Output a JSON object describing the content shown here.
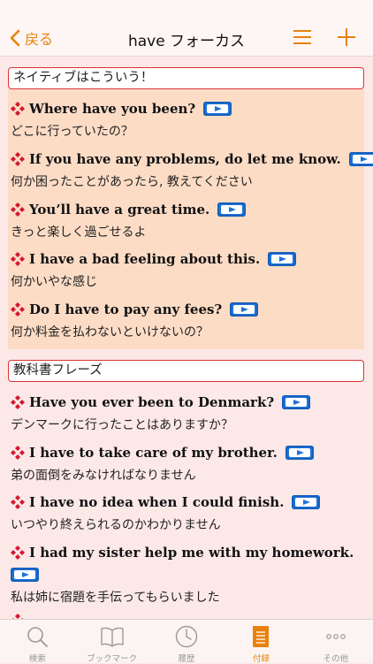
{
  "nav": {
    "back_label": "戻る",
    "title": "have フォーカス"
  },
  "colors": {
    "accent": "#e8820c",
    "bullet": "#d6152c",
    "play": "#1e73d8",
    "highlight_box": "#fddcc6",
    "background": "#fde8e8"
  },
  "sections": [
    {
      "title": "ネイティブはこういう！",
      "phrases": [
        {
          "en": "Where have you been?",
          "ja": "どこに行っていたの？"
        },
        {
          "en": "If you have any problems, do let me know.",
          "ja": "何か困ったことがあったら, 教えてください"
        },
        {
          "en": "You’ll have a great time.",
          "ja": "きっと楽しく過ごせるよ"
        },
        {
          "en": "I have a bad feeling about this.",
          "ja": "何かいやな感じ"
        },
        {
          "en": "Do I have to pay any fees?",
          "ja": "何か料金を払わないといけないの？"
        }
      ]
    },
    {
      "title": "教科書フレーズ",
      "phrases": [
        {
          "en": "Have you ever been to Denmark?",
          "ja": "デンマークに行ったことはありますか？"
        },
        {
          "en": "I have to take care of my brother.",
          "ja": "弟の面倒をみなければなりません"
        },
        {
          "en": "I have no idea when I could finish.",
          "ja": "いつやり終えられるのかわかりません"
        },
        {
          "en": "I had my sister help me with my homework.",
          "ja": "私は姉に宿題を手伝ってもらいました"
        }
      ]
    }
  ],
  "tabs": [
    {
      "label": "検索",
      "icon": "magnifier-icon"
    },
    {
      "label": "ブックマーク",
      "icon": "book-icon"
    },
    {
      "label": "履歴",
      "icon": "clock-icon"
    },
    {
      "label": "付録",
      "icon": "document-icon",
      "active": true
    },
    {
      "label": "その他",
      "icon": "more-dots-icon"
    }
  ]
}
